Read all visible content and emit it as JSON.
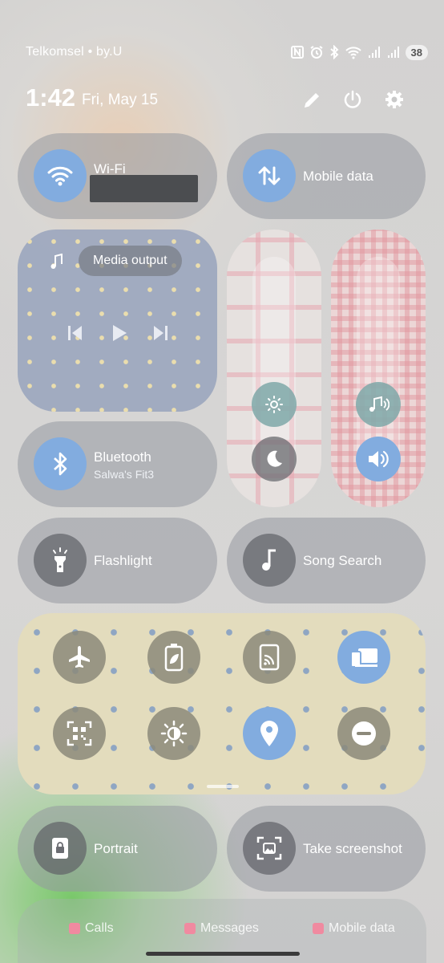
{
  "status_bar": {
    "carrier": "Telkomsel • by.U",
    "battery": "38",
    "icons": [
      "nfc-icon",
      "alarm-icon",
      "bluetooth-icon",
      "wifi-icon",
      "signal-icon",
      "signal-icon"
    ]
  },
  "header": {
    "time": "1:42",
    "date": "Fri, May 15",
    "actions": [
      "edit-icon",
      "power-icon",
      "settings-icon"
    ]
  },
  "tiles": {
    "wifi": {
      "label": "Wi-Fi",
      "active": true
    },
    "mobile_data": {
      "label": "Mobile data",
      "active": true
    },
    "media": {
      "output_label": "Media output"
    },
    "bluetooth": {
      "label": "Bluetooth",
      "sub": "Salwa's Fit3",
      "active": true
    },
    "flashlight": {
      "label": "Flashlight",
      "active": false
    },
    "song_search": {
      "label": "Song Search",
      "active": false
    },
    "portrait": {
      "label": "Portrait",
      "active": false
    },
    "take_screenshot": {
      "label": "Take screenshot",
      "active": false
    }
  },
  "quick_grid": [
    {
      "icon": "airplane-icon",
      "active": false
    },
    {
      "icon": "battery-saver-icon",
      "active": false
    },
    {
      "icon": "cast-icon",
      "active": false
    },
    {
      "icon": "device-connect-icon",
      "active": true
    },
    {
      "icon": "qr-scanner-icon",
      "active": false
    },
    {
      "icon": "eye-comfort-icon",
      "active": false
    },
    {
      "icon": "location-icon",
      "active": true
    },
    {
      "icon": "dnd-icon",
      "active": false
    }
  ],
  "bottom_row": [
    "Calls",
    "Messages",
    "Mobile data"
  ],
  "colors": {
    "active_blue": "#82acdf",
    "tile_bg": "#9699a0",
    "panel_yellow": "#e3dcbd"
  }
}
